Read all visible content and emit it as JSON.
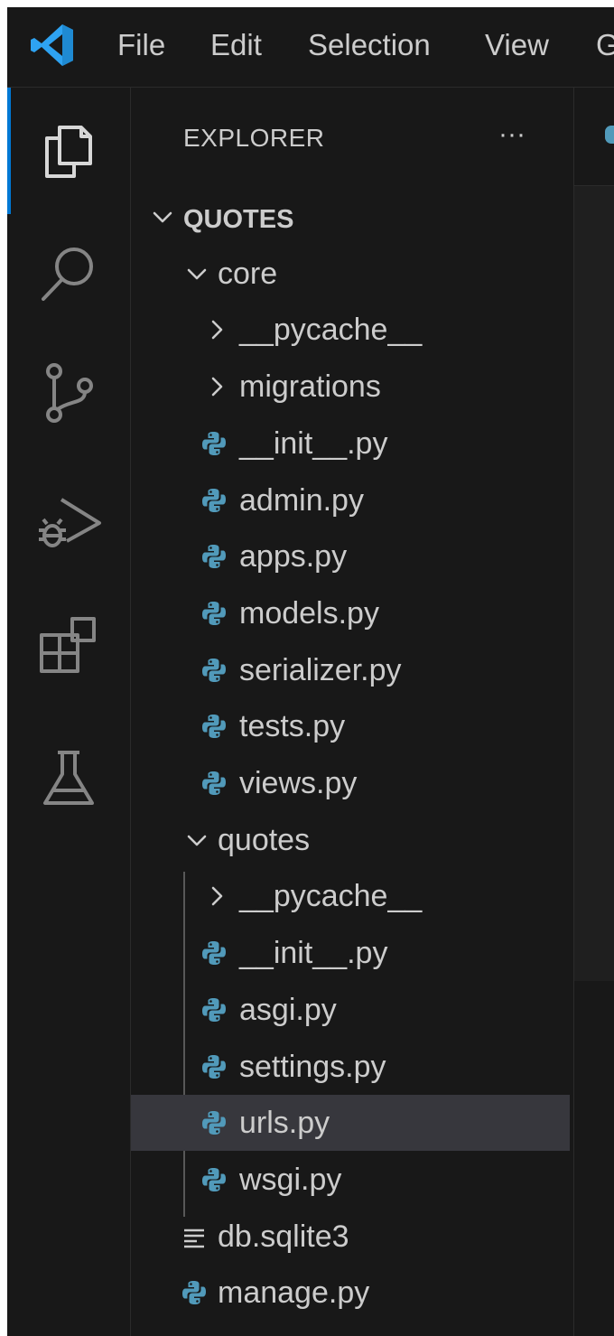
{
  "menu": [
    "File",
    "Edit",
    "Selection",
    "View",
    "G"
  ],
  "activity_bar": [
    "explorer-icon",
    "search-icon",
    "source-control-icon",
    "run-debug-icon",
    "extensions-icon",
    "testing-icon"
  ],
  "explorer": {
    "title": "EXPLORER",
    "more_label": "···",
    "items": [
      {
        "label": "QUOTES",
        "type": "root",
        "depth": 0
      },
      {
        "label": "core",
        "type": "folder-open",
        "depth": 1
      },
      {
        "label": "__pycache__",
        "type": "folder-closed",
        "depth": 2
      },
      {
        "label": "migrations",
        "type": "folder-closed",
        "depth": 2
      },
      {
        "label": "__init__.py",
        "type": "python-file",
        "depth": 2
      },
      {
        "label": "admin.py",
        "type": "python-file",
        "depth": 2
      },
      {
        "label": "apps.py",
        "type": "python-file",
        "depth": 2
      },
      {
        "label": "models.py",
        "type": "python-file",
        "depth": 2
      },
      {
        "label": "serializer.py",
        "type": "python-file",
        "depth": 2
      },
      {
        "label": "tests.py",
        "type": "python-file",
        "depth": 2
      },
      {
        "label": "views.py",
        "type": "python-file",
        "depth": 2
      },
      {
        "label": "quotes",
        "type": "folder-open",
        "depth": 1
      },
      {
        "label": "__pycache__",
        "type": "folder-closed",
        "depth": 2
      },
      {
        "label": "__init__.py",
        "type": "python-file",
        "depth": 2
      },
      {
        "label": "asgi.py",
        "type": "python-file",
        "depth": 2
      },
      {
        "label": "settings.py",
        "type": "python-file",
        "depth": 2
      },
      {
        "label": "urls.py",
        "type": "python-file",
        "depth": 2,
        "selected": true
      },
      {
        "label": "wsgi.py",
        "type": "python-file",
        "depth": 2
      },
      {
        "label": "db.sqlite3",
        "type": "text-file",
        "depth": 1
      },
      {
        "label": "manage.py",
        "type": "python-file",
        "depth": 1
      }
    ]
  },
  "colors": {
    "background": "#181818",
    "accent": "#0078d4",
    "python_icon": "#519aba",
    "selection": "#37373d",
    "text": "#cccccc"
  }
}
